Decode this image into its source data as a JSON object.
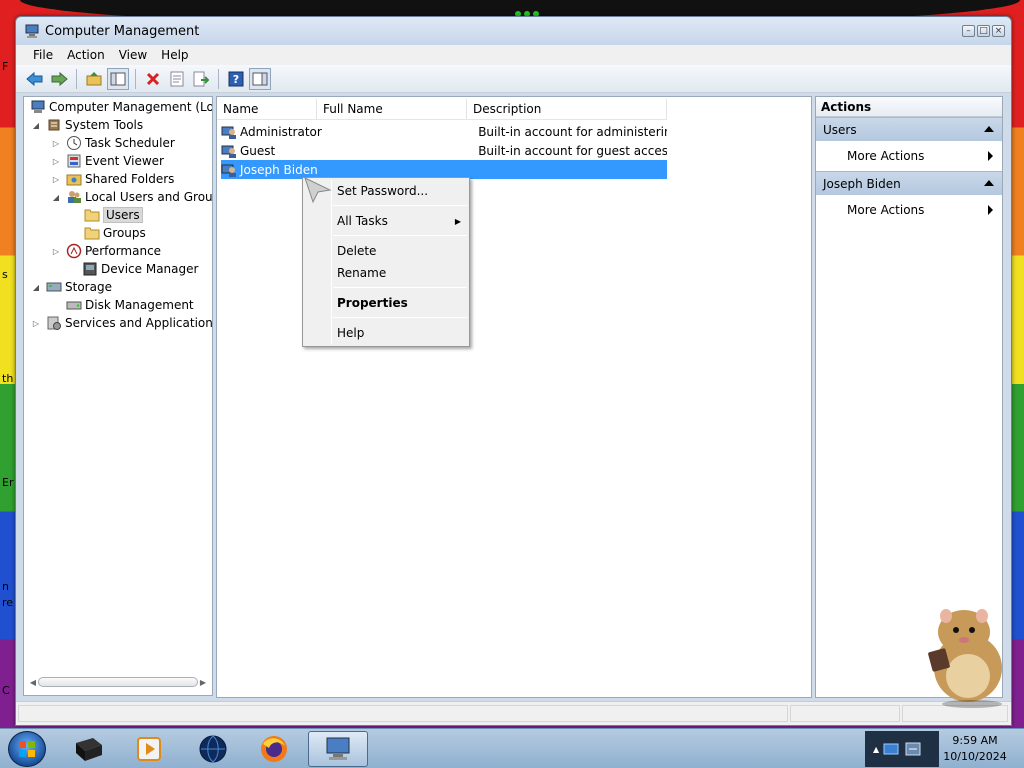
{
  "background": {
    "edge_letters": [
      "F",
      "s",
      "th",
      "Er",
      "n",
      "re",
      "C"
    ]
  },
  "window": {
    "title": "Computer Management",
    "controls": [
      "minimize",
      "maximize",
      "close"
    ]
  },
  "menu": [
    "File",
    "Action",
    "View",
    "Help"
  ],
  "toolbar_icons": [
    "back-arrow-icon",
    "forward-arrow-icon",
    "up-folder-icon",
    "show-hide-tree-icon",
    "delete-icon",
    "properties-icon",
    "export-list-icon",
    "help-icon",
    "show-hide-action-pane-icon"
  ],
  "tree": {
    "items": [
      {
        "label": "Computer Management (Local",
        "level": 0,
        "expander": "",
        "icon": "computer-management-icon"
      },
      {
        "label": "System Tools",
        "level": 1,
        "expander": "◢",
        "icon": "system-tools-icon"
      },
      {
        "label": "Task Scheduler",
        "level": 2,
        "expander": "▷",
        "icon": "clock-icon"
      },
      {
        "label": "Event Viewer",
        "level": 2,
        "expander": "▷",
        "icon": "event-viewer-icon"
      },
      {
        "label": "Shared Folders",
        "level": 2,
        "expander": "▷",
        "icon": "shared-folder-icon"
      },
      {
        "label": "Local Users and Groups",
        "level": 2,
        "expander": "◢",
        "icon": "users-groups-icon"
      },
      {
        "label": "Users",
        "level": 3,
        "expander": "",
        "icon": "folder-icon",
        "selected": true
      },
      {
        "label": "Groups",
        "level": 3,
        "expander": "",
        "icon": "folder-icon"
      },
      {
        "label": "Performance",
        "level": 2,
        "expander": "▷",
        "icon": "performance-icon"
      },
      {
        "label": "Device Manager",
        "level": 2,
        "expander": "",
        "icon": "device-manager-icon"
      },
      {
        "label": "Storage",
        "level": 1,
        "expander": "◢",
        "icon": "storage-icon"
      },
      {
        "label": "Disk Management",
        "level": 2,
        "expander": "",
        "icon": "disk-icon"
      },
      {
        "label": "Services and Applications",
        "level": 1,
        "expander": "▷",
        "icon": "services-icon"
      }
    ]
  },
  "list": {
    "columns": [
      "Name",
      "Full Name",
      "Description"
    ],
    "rows": [
      {
        "name": "Administrator",
        "full_name": "",
        "description": "Built-in account for administering...",
        "selected": false
      },
      {
        "name": "Guest",
        "full_name": "",
        "description": "Built-in account for guest access t...",
        "selected": false
      },
      {
        "name": "Joseph Biden",
        "full_name": "",
        "description": "",
        "selected": true
      }
    ]
  },
  "context_menu": {
    "items": [
      {
        "label": "Set Password...",
        "bold": false,
        "submenu": false
      },
      {
        "label": "All Tasks",
        "bold": false,
        "submenu": true
      },
      {
        "label": "Delete",
        "bold": false,
        "submenu": false
      },
      {
        "label": "Rename",
        "bold": false,
        "submenu": false
      },
      {
        "label": "Properties",
        "bold": true,
        "submenu": false
      },
      {
        "label": "Help",
        "bold": false,
        "submenu": false
      }
    ]
  },
  "actions": {
    "title": "Actions",
    "sections": [
      {
        "header": "Users",
        "items": [
          "More Actions"
        ]
      },
      {
        "header": "Joseph Biden",
        "items": [
          "More Actions"
        ]
      }
    ]
  },
  "taskbar": {
    "apps": [
      "terminal-icon",
      "media-player-icon",
      "globe-icon",
      "firefox-icon",
      "computer-management-icon"
    ],
    "active_app": "computer-management-icon",
    "clock_time": "9:59 AM",
    "clock_date": "10/10/2024"
  },
  "colors": {
    "selection": "#3399ff",
    "actions_header": "#c9d8e9"
  }
}
